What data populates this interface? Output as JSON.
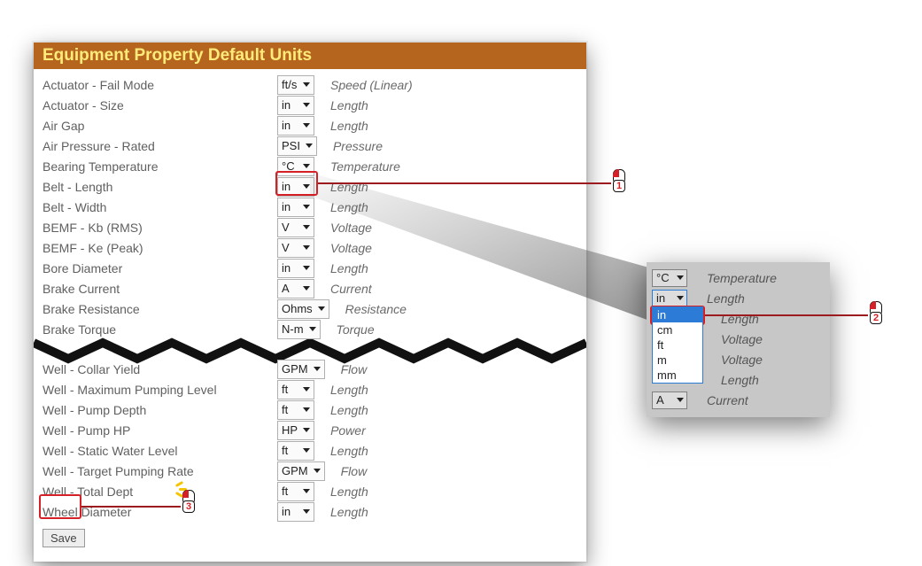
{
  "header": {
    "title": "Equipment Property Default Units"
  },
  "rows_top": [
    {
      "label": "Actuator - Fail Mode",
      "value": "ft/s",
      "category": "Speed (Linear)"
    },
    {
      "label": "Actuator - Size",
      "value": "in",
      "category": "Length"
    },
    {
      "label": "Air Gap",
      "value": "in",
      "category": "Length"
    },
    {
      "label": "Air Pressure - Rated",
      "value": "PSI",
      "category": "Pressure"
    },
    {
      "label": "Bearing Temperature",
      "value": "°C",
      "category": "Temperature"
    },
    {
      "label": "Belt - Length",
      "value": "in",
      "category": "Length"
    },
    {
      "label": "Belt - Width",
      "value": "in",
      "category": "Length"
    },
    {
      "label": "BEMF - Kb (RMS)",
      "value": "V",
      "category": "Voltage"
    },
    {
      "label": "BEMF - Ke (Peak)",
      "value": "V",
      "category": "Voltage"
    },
    {
      "label": "Bore Diameter",
      "value": "in",
      "category": "Length"
    },
    {
      "label": "Brake Current",
      "value": "A",
      "category": "Current"
    },
    {
      "label": "Brake Resistance",
      "value": "Ohms",
      "category": "Resistance"
    },
    {
      "label": "Brake Torque",
      "value": "N-m",
      "category": "Torque"
    }
  ],
  "rows_bottom": [
    {
      "label": "Well - Collar Yield",
      "value": "GPM",
      "category": "Flow"
    },
    {
      "label": "Well - Maximum Pumping Level",
      "value": "ft",
      "category": "Length"
    },
    {
      "label": "Well - Pump Depth",
      "value": "ft",
      "category": "Length"
    },
    {
      "label": "Well - Pump HP",
      "value": "HP",
      "category": "Power"
    },
    {
      "label": "Well - Static Water Level",
      "value": "ft",
      "category": "Length"
    },
    {
      "label": "Well - Target Pumping Rate",
      "value": "GPM",
      "category": "Flow"
    },
    {
      "label": "Well - Total Dept",
      "value": "ft",
      "category": "Length"
    },
    {
      "label": "Wheel Diameter",
      "value": "in",
      "category": "Length"
    }
  ],
  "save": {
    "label": "Save"
  },
  "zoom": {
    "rows": [
      {
        "value": "°C",
        "category": "Temperature"
      },
      {
        "value": "in",
        "category": "Length"
      },
      {
        "value": "",
        "category": "Length"
      },
      {
        "value": "",
        "category": "Voltage"
      },
      {
        "value": "",
        "category": "Voltage"
      },
      {
        "value": "",
        "category": "Length"
      },
      {
        "value": "A",
        "category": "Current"
      }
    ],
    "dropdown": {
      "options": [
        "in",
        "cm",
        "ft",
        "m",
        "mm"
      ],
      "selected": "in"
    }
  },
  "callouts": {
    "step1": "1",
    "step2": "2",
    "step3": "3"
  }
}
